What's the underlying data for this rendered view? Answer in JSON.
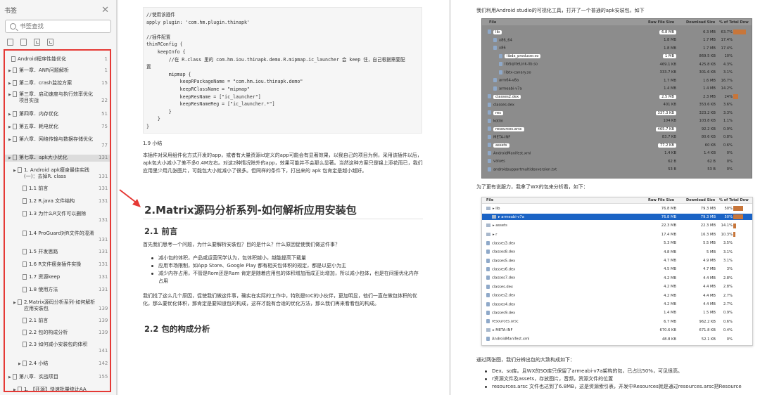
{
  "sidebar": {
    "title": "书签",
    "search_placeholder": "书签查找",
    "items": [
      {
        "title": "Android程序性能优化",
        "page": "1"
      },
      {
        "title": "第一章．ANR问题解析",
        "page": "1"
      },
      {
        "title": "第二章．crash监控方案",
        "page": "15"
      },
      {
        "title": "第三章．启动速度与执行效率优化项目实战",
        "page": "22"
      },
      {
        "title": "第四章．内存优化",
        "page": "51"
      },
      {
        "title": "第五章．耗电优化",
        "page": "75"
      },
      {
        "title": "第六章．网络传输与数据存储优化",
        "page": "77"
      },
      {
        "title": "第七章．apk大小优化",
        "page": "131"
      },
      {
        "title": "1. Android apk瘦身最佳实践(一)：去掉R. class",
        "page": "131"
      },
      {
        "title": "1.1 前言",
        "page": "131"
      },
      {
        "title": "1.2 R.java 文件结构",
        "page": "131"
      },
      {
        "title": "1.3 为什么R文件可以删除",
        "page": "131"
      },
      {
        "title": "1.4 ProGuard对R文件的混淆",
        "page": "131"
      },
      {
        "title": "1.5 开发思路",
        "page": "131"
      },
      {
        "title": "1.6 R文件瘦身插件实操",
        "page": "131"
      },
      {
        "title": "1.7 资源keep",
        "page": "131"
      },
      {
        "title": "1.8 使用方法",
        "page": "131"
      },
      {
        "title": "2.Matrix源码分析系列-如何解析应用安装包",
        "page": "139"
      },
      {
        "title": "2.1 前言",
        "page": "139"
      },
      {
        "title": "2.2 包的构成分析",
        "page": "139"
      },
      {
        "title": "2.3 如何减小安装包的体积",
        "page": "141"
      },
      {
        "title": "2.4 小结",
        "page": "142"
      },
      {
        "title": "第八章．实战项目",
        "page": "155"
      },
      {
        "title": "1. 【开源】快速批量统计AA",
        "page": ""
      }
    ]
  },
  "page_left": {
    "code_lines": [
      "//使用该插件",
      "apply plugin: 'com.hm.plugin.thinapk'",
      "",
      "//插件配置",
      "thinRConfig {",
      "    keepInfo {",
      "        //在 R.class 里的 com.hm.iou.thinapk.demo.R.mipmap.ic_launcher 会 keep 住，自己根据需要配",
      "置",
      "        mipmap {",
      "            keepRPackageName = \"com.hm.iou.thinapk.demo\"",
      "            keepRClassName = \"mipmap\"",
      "            keepResName = [\"ic_launcher\"]",
      "            keepResNameReg = [\"ic_launcher.*\"]",
      "        }",
      "    }",
      "}"
    ],
    "section_19": "1.9 小结",
    "para_19": "本插件对采用组件化方式开发的app，或者有大量资源id定义的app可能会有显著效果，以我自己的项目为例，采用该插件以后，apk包大小减小了差不多0.4M左右。对这2种情况除外的app，效果可能并不会那么显著。当然这种方案只是锦上添花而已，我们应用里少用几张图片，可能包大小就减小了很多。但同样的条件下，打出来的 apk 包肯定是越小越好。",
    "h1": "2.Matrix源码分析系列-如何解析应用安装包",
    "h2_1": "2.1 前言",
    "para_21": "首先我们思考一个问题，为什么要解析安装包？目的是什么？什么原因促使我们做这件事？",
    "bullets": [
      "减小包的体积，产品或运营同学认为，包体积越小，越能提高下载量",
      "应用市场限制，如App Store、Google Play 都有相关包体积的规定，都是以更小为主",
      "减少内存占用，不管是Rom还是Ram 肯定是随着应用包的体积增加而成正比增加，所以减小包体，也是在间接优化内存占用"
    ],
    "para_22a": "我们找了这么几个原因，促使我们做这件事，确实在实际的工作中，特别是toC的小伙伴，更加明显，他们一直在做包体积的优化，那么要优化体积，那肯定是要知道包的构成，这样才能有合适的优化方法，那么我们再来看看包的构成。",
    "h2_2": "2.2 包的构成分析"
  },
  "page_right": {
    "intro": "我们利用Android studio的可视化工具，打开了一个普通的apk安装包，如下",
    "analyzer1": {
      "headers": [
        "File",
        "Raw File Size",
        "Download Size",
        "% of Total Dow"
      ],
      "rows": [
        {
          "name": "lib",
          "raw": "6.8 MB",
          "dl": "6.3 MB",
          "pct": "63.7%",
          "bar": 0.64,
          "lvl": 0,
          "tag": true
        },
        {
          "name": "x86_64",
          "raw": "1.8 MB",
          "dl": "1.7 MB",
          "pct": "17.4%",
          "bar": 0,
          "lvl": 1
        },
        {
          "name": "x86",
          "raw": "1.8 MB",
          "dl": "1.7 MB",
          "pct": "17.4%",
          "bar": 0,
          "lvl": 1
        },
        {
          "name": "libdx_producer.so",
          "raw": "1 MB",
          "dl": "869.5 KB",
          "pct": "10%",
          "bar": 0,
          "lvl": 2,
          "tag": true
        },
        {
          "name": "libSqliteLink-lib.so",
          "raw": "469.1 KB",
          "dl": "425.8 KB",
          "pct": "4.3%",
          "bar": 0,
          "lvl": 2
        },
        {
          "name": "libtx-canary.so",
          "raw": "333.7 KB",
          "dl": "301.6 KB",
          "pct": "3.1%",
          "bar": 0,
          "lvl": 2
        },
        {
          "name": "arm64-v8a",
          "raw": "1.7 MB",
          "dl": "1.6 MB",
          "pct": "16.7%",
          "bar": 0,
          "lvl": 1
        },
        {
          "name": "armeabi-v7a",
          "raw": "1.4 MB",
          "dl": "1.4 MB",
          "pct": "14.2%",
          "bar": 0,
          "lvl": 1
        },
        {
          "name": "classes2.dex",
          "raw": "2.5 MB",
          "dl": "2.3 MB",
          "pct": "24%",
          "bar": 0.24,
          "lvl": 0,
          "tag": true
        },
        {
          "name": "classes.dex",
          "raw": "401 KB",
          "dl": "353.6 KB",
          "pct": "3.6%",
          "bar": 0,
          "lvl": 0
        },
        {
          "name": "res",
          "raw": "337.3 KB",
          "dl": "323.2 KB",
          "pct": "3.3%",
          "bar": 0,
          "lvl": 0,
          "tag": true
        },
        {
          "name": "kotlin",
          "raw": "104 KB",
          "dl": "103.8 KB",
          "pct": "1.1%",
          "bar": 0,
          "lvl": 0
        },
        {
          "name": "resources.arsc",
          "raw": "465.7 KB",
          "dl": "92.2 KB",
          "pct": "0.9%",
          "bar": 0,
          "lvl": 0,
          "tag": true
        },
        {
          "name": "META-INF",
          "raw": "83.7 KB",
          "dl": "80.6 KB",
          "pct": "0.8%",
          "bar": 0,
          "lvl": 0
        },
        {
          "name": "assets",
          "raw": "77.2 KB",
          "dl": "60 KB",
          "pct": "0.6%",
          "bar": 0,
          "lvl": 0,
          "tag": true
        },
        {
          "name": "AndroidManifest.xml",
          "raw": "1.4 KB",
          "dl": "1.4 KB",
          "pct": "0%",
          "bar": 0,
          "lvl": 0
        },
        {
          "name": "values",
          "raw": "62 B",
          "dl": "62 B",
          "pct": "0%",
          "bar": 0,
          "lvl": 0
        },
        {
          "name": "androidsupportmultidexversion.txt",
          "raw": "53 B",
          "dl": "53 B",
          "pct": "0%",
          "bar": 0,
          "lvl": 0
        }
      ]
    },
    "mid": "为了更有说服力，我拿了WX的包来分析看，如下：",
    "analyzer2": {
      "headers": [
        "File",
        "Raw File Size",
        "Download Size",
        "% of Total Dow"
      ],
      "rows": [
        {
          "name": "lib",
          "raw": "76.8 MB",
          "dl": "79.3 MB",
          "pct": "50%",
          "bar": 0.5,
          "lvl": 0,
          "dir": true
        },
        {
          "name": "armeabi-v7a",
          "raw": "76.8 MB",
          "dl": "79.3 MB",
          "pct": "50%",
          "bar": 0.5,
          "lvl": 1,
          "dir": true,
          "sel": true
        },
        {
          "name": "assets",
          "raw": "22.3 MB",
          "dl": "22.3 MB",
          "pct": "14.1%",
          "bar": 0.14,
          "lvl": 0,
          "dir": true
        },
        {
          "name": "r",
          "raw": "17.4 MB",
          "dl": "16.3 MB",
          "pct": "10.3%",
          "bar": 0.1,
          "lvl": 0,
          "dir": true
        },
        {
          "name": "classes3.dex",
          "raw": "5.3 MB",
          "dl": "5.5 MB",
          "pct": "3.5%",
          "bar": 0,
          "lvl": 0
        },
        {
          "name": "classes8.dex",
          "raw": "4.8 MB",
          "dl": "5 MB",
          "pct": "3.1%",
          "bar": 0,
          "lvl": 0
        },
        {
          "name": "classes5.dex",
          "raw": "4.7 MB",
          "dl": "4.9 MB",
          "pct": "3.1%",
          "bar": 0,
          "lvl": 0
        },
        {
          "name": "classes6.dex",
          "raw": "4.5 MB",
          "dl": "4.7 MB",
          "pct": "3%",
          "bar": 0,
          "lvl": 0
        },
        {
          "name": "classes7.dex",
          "raw": "4.2 MB",
          "dl": "4.4 MB",
          "pct": "2.8%",
          "bar": 0,
          "lvl": 0
        },
        {
          "name": "classes.dex",
          "raw": "4.2 MB",
          "dl": "4.4 MB",
          "pct": "2.8%",
          "bar": 0,
          "lvl": 0
        },
        {
          "name": "classes2.dex",
          "raw": "4.2 MB",
          "dl": "4.4 MB",
          "pct": "2.7%",
          "bar": 0,
          "lvl": 0
        },
        {
          "name": "classes4.dex",
          "raw": "4.2 MB",
          "dl": "4.4 MB",
          "pct": "2.7%",
          "bar": 0,
          "lvl": 0
        },
        {
          "name": "classes9.dex",
          "raw": "1.4 MB",
          "dl": "1.5 MB",
          "pct": "0.9%",
          "bar": 0,
          "lvl": 0
        },
        {
          "name": "resources.arsc",
          "raw": "6.7 MB",
          "dl": "962.2 KB",
          "pct": "0.6%",
          "bar": 0,
          "lvl": 0
        },
        {
          "name": "META-INF",
          "raw": "670.6 KB",
          "dl": "671.8 KB",
          "pct": "0.4%",
          "bar": 0,
          "lvl": 0,
          "dir": true
        },
        {
          "name": "AndroidManifest.xml",
          "raw": "48.8 KB",
          "dl": "52.1 KB",
          "pct": "0%",
          "bar": 0,
          "lvl": 0
        }
      ]
    },
    "conclusion": "通过两张图，我们分辨出包的大致构成如下：",
    "bullets": [
      "Dex、so库。且WX的SO库只保留了armeabi-v7a架构的包，已占比50%，可见很高。",
      "r资源文件及assets，存放图片，音频，资源文件的位置",
      "resources.arsc 文件也达到了6.8MB，这是资源索引表，开发中Resources就是通过resources.arsc把Resource"
    ]
  },
  "colors": {
    "highlight_border": "#e53935",
    "arrow": "#e53935",
    "selection": "#1a63c5",
    "bar": "#c8763a"
  }
}
